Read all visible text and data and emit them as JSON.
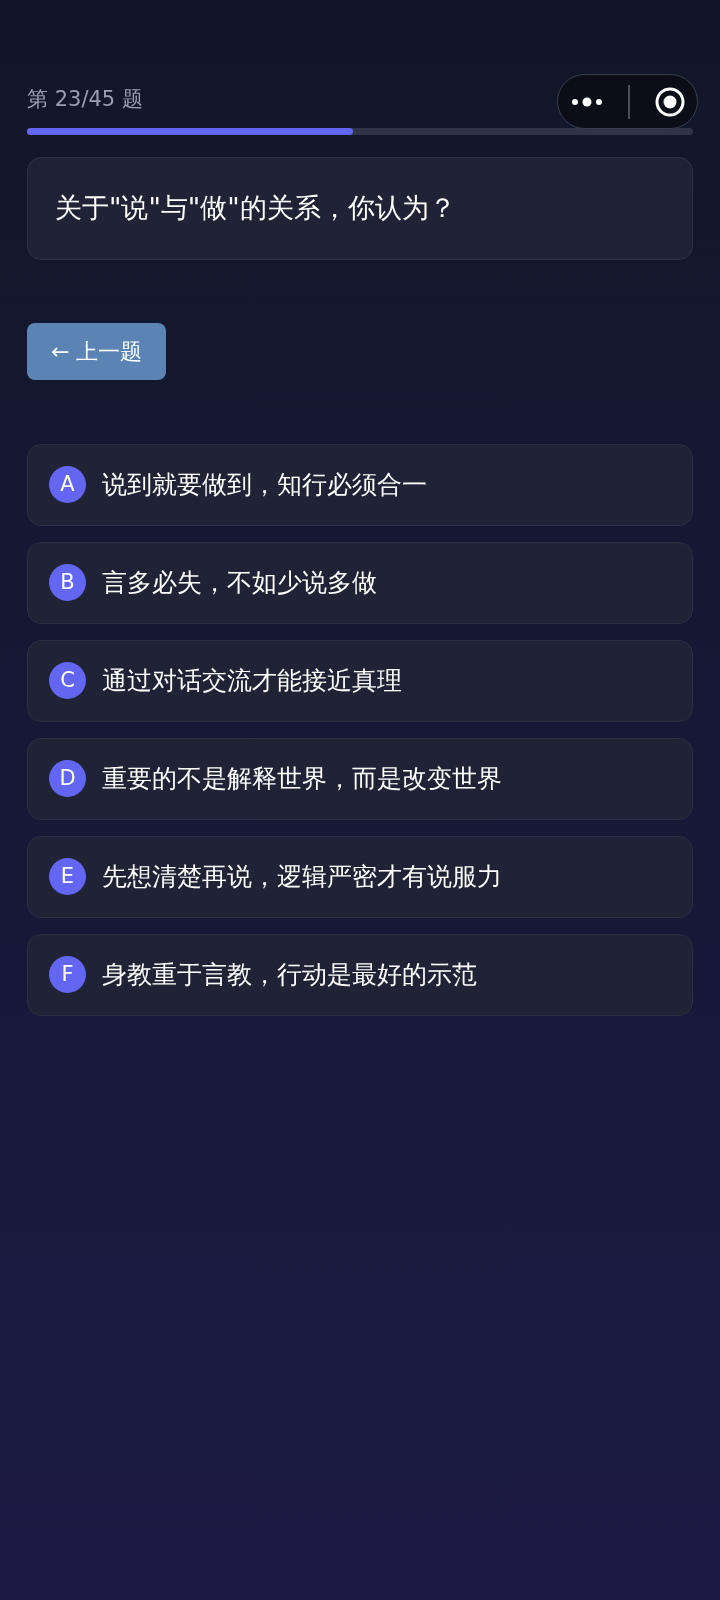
{
  "progress": {
    "label": "第 23/45 题",
    "level": 0.49
  },
  "question": "关于\"说\"与\"做\"的关系，你认为？",
  "prev_button": {
    "label": "← 上一题"
  },
  "options": [
    {
      "letter": "A",
      "text": "说到就要做到，知行必须合一",
      "selected": false
    },
    {
      "letter": "B",
      "text": "言多必失，不如少说多做",
      "selected": false
    },
    {
      "letter": "C",
      "text": "通过对话交流才能接近真理",
      "selected": false
    },
    {
      "letter": "D",
      "text": "重要的不是解释世界，而是改变世界",
      "selected": false
    },
    {
      "letter": "E",
      "text": "先想清楚再说，逻辑严密才有说服力",
      "selected": false
    },
    {
      "letter": "F",
      "text": "身教重于言教，行动是最好的示范",
      "selected": false
    }
  ]
}
